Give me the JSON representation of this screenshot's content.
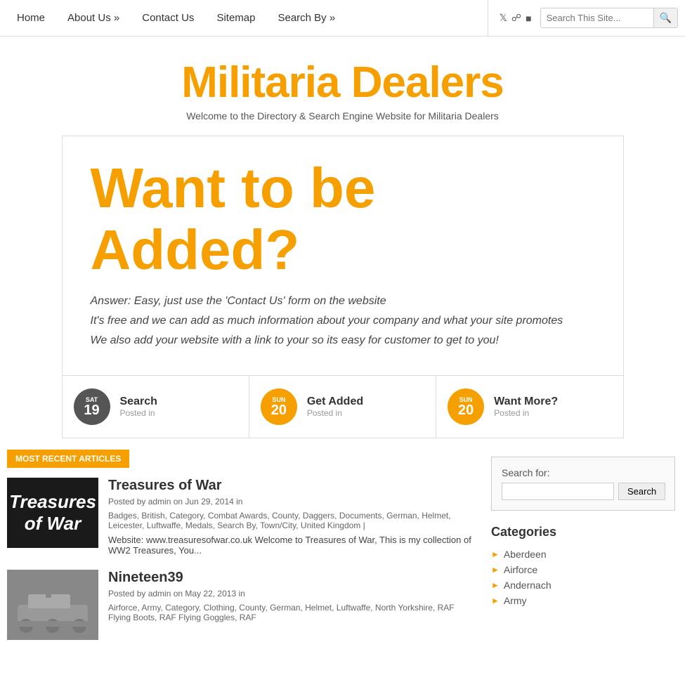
{
  "nav": {
    "home": "Home",
    "about": "About Us »",
    "contact": "Contact Us",
    "sitemap": "Sitemap",
    "searchBy": "Search By »",
    "searchPlaceholder": "Search This Site...",
    "icons": [
      "twitter",
      "rss",
      "facebook"
    ]
  },
  "header": {
    "title": "Militaria Dealers",
    "subtitle": "Welcome to the Directory & Search Engine Website for Militaria Dealers"
  },
  "hero": {
    "title": "Want to be Added?",
    "lines": [
      "Answer: Easy, just use the 'Contact Us' form on the website",
      "It's free and we can add as much information about your company and what your site promotes",
      "We also add your website with a link to your so its easy for customer to get to you!"
    ]
  },
  "teasers": [
    {
      "dayName": "SAT",
      "dayNum": "19",
      "orange": false,
      "title": "Search",
      "meta": "Posted in"
    },
    {
      "dayName": "SUN",
      "dayNum": "20",
      "orange": true,
      "title": "Get Added",
      "meta": "Posted in"
    },
    {
      "dayName": "SUN",
      "dayNum": "20",
      "orange": true,
      "title": "Want More?",
      "meta": "Posted in"
    }
  ],
  "mostRecent": {
    "label": "Most Recent Articles"
  },
  "articles": [
    {
      "id": "tow",
      "thumbType": "tow",
      "thumbText": "Treasures of War",
      "title": "Treasures of War",
      "meta": "Posted by admin on Jun 29, 2014 in",
      "tags": "Badges, British, Category, Combat Awards, County, Daggers, Documents, German, Helmet, Leicester, Luftwaffe, Medals, Search By, Town/City, United Kingdom |",
      "excerpt": "Website: www.treasuresofwar.co.uk Welcome to Treasures of War, This is my collection of WW2 Treasures, You..."
    },
    {
      "id": "nineteen39",
      "thumbType": "tank",
      "thumbText": "",
      "title": "Nineteen39",
      "meta": "Posted by admin on May 22, 2013 in",
      "tags": "Airforce, Army, Category, Clothing, County, German, Helmet, Luftwaffe, North Yorkshire, RAF Flying Boots, RAF Flying Goggles, RAF",
      "excerpt": ""
    }
  ],
  "sidebar": {
    "searchLabel": "Search for:",
    "searchBtn": "Search",
    "categoriesTitle": "Categories",
    "categories": [
      "Aberdeen",
      "Airforce",
      "Andernach",
      "Army"
    ]
  }
}
